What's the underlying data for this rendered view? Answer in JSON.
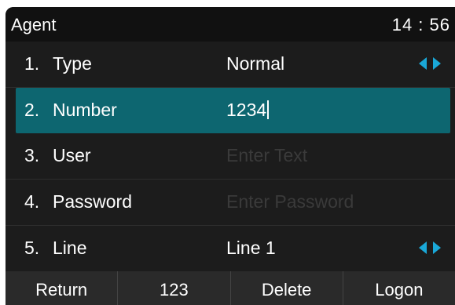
{
  "header": {
    "title": "Agent",
    "time": "14 : 56"
  },
  "rows": [
    {
      "num": "1.",
      "label": "Type",
      "value": "Normal",
      "has_arrows": true
    },
    {
      "num": "2.",
      "label": "Number",
      "value": "1234",
      "selected": true
    },
    {
      "num": "3.",
      "label": "User",
      "placeholder": "Enter Text"
    },
    {
      "num": "4.",
      "label": "Password",
      "placeholder": "Enter Password"
    },
    {
      "num": "5.",
      "label": "Line",
      "value": "Line 1",
      "has_arrows": true
    }
  ],
  "softkeys": [
    "Return",
    "123",
    "Delete",
    "Logon"
  ],
  "colors": {
    "selected_row": "#0d6670",
    "arrow_accent": "#1aa8d8",
    "background": "#1c1c1c"
  },
  "icons": {
    "arrows": "left-right-arrows-icon"
  }
}
